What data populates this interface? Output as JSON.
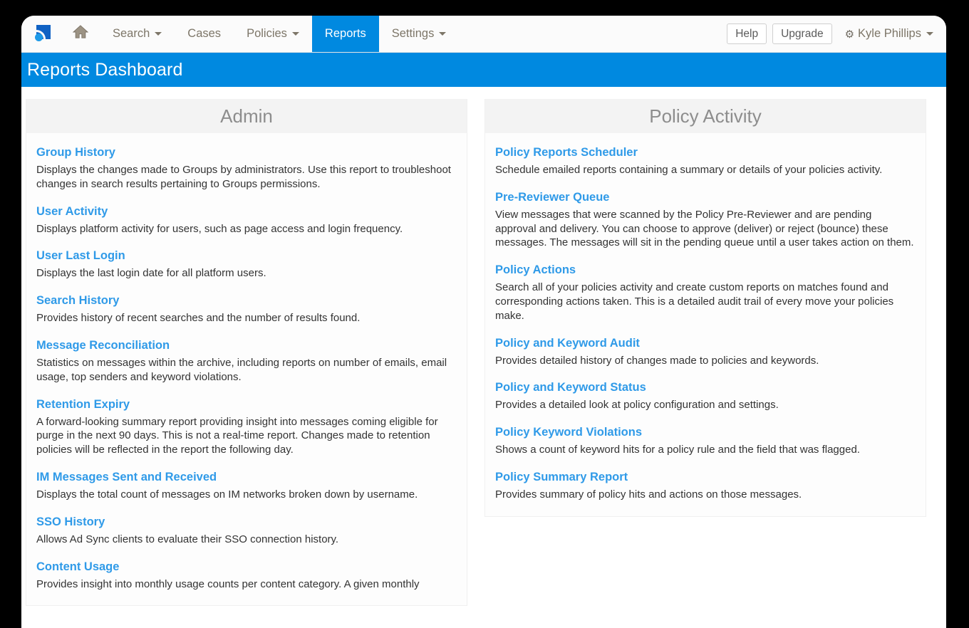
{
  "navbar": {
    "brand_icon": "signal-logo-icon",
    "home_icon": "home-icon",
    "items": [
      {
        "label": "Search",
        "has_caret": true,
        "active": false
      },
      {
        "label": "Cases",
        "has_caret": false,
        "active": false
      },
      {
        "label": "Policies",
        "has_caret": true,
        "active": false
      },
      {
        "label": "Reports",
        "has_caret": false,
        "active": true
      },
      {
        "label": "Settings",
        "has_caret": true,
        "active": false
      }
    ],
    "help_label": "Help",
    "upgrade_label": "Upgrade",
    "user_name": "Kyle Phillips",
    "user_icon": "gear-icon"
  },
  "banner": {
    "title": "Reports Dashboard",
    "color": "#0089e0"
  },
  "columns": [
    {
      "title": "Admin",
      "items": [
        {
          "title": "Group History",
          "desc": "Displays the changes made to Groups by administrators. Use this report to troubleshoot changes in search results pertaining to Groups permissions."
        },
        {
          "title": "User Activity",
          "desc": "Displays platform activity for users, such as page access and login frequency."
        },
        {
          "title": "User Last Login",
          "desc": "Displays the last login date for all platform users."
        },
        {
          "title": "Search History",
          "desc": "Provides history of recent searches and the number of results found."
        },
        {
          "title": "Message Reconciliation",
          "desc": "Statistics on messages within the archive, including reports on number of emails, email usage, top senders and keyword violations."
        },
        {
          "title": "Retention Expiry",
          "desc": "A forward-looking summary report providing insight into messages coming eligible for purge in the next 90 days. This is not a real-time report. Changes made to retention policies will be reflected in the report the following day."
        },
        {
          "title": "IM Messages Sent and Received",
          "desc": "Displays the total count of messages on IM networks broken down by username."
        },
        {
          "title": "SSO History",
          "desc": "Allows Ad Sync clients to evaluate their SSO connection history."
        },
        {
          "title": "Content Usage",
          "desc": "Provides insight into monthly usage counts per content category. A given monthly"
        }
      ]
    },
    {
      "title": "Policy Activity",
      "items": [
        {
          "title": "Policy Reports Scheduler",
          "desc": "Schedule emailed reports containing a summary or details of your policies activity."
        },
        {
          "title": "Pre-Reviewer Queue",
          "desc": "View messages that were scanned by the Policy Pre-Reviewer and are pending approval and delivery. You can choose to approve (deliver) or reject (bounce) these messages. The messages will sit in the pending queue until a user takes action on them."
        },
        {
          "title": "Policy Actions",
          "desc": "Search all of your policies activity and create custom reports on matches found and corresponding actions taken. This is a detailed audit trail of every move your policies make."
        },
        {
          "title": "Policy and Keyword Audit",
          "desc": "Provides detailed history of changes made to policies and keywords."
        },
        {
          "title": "Policy and Keyword Status",
          "desc": "Provides a detailed look at policy configuration and settings."
        },
        {
          "title": "Policy Keyword Violations",
          "desc": "Shows a count of keyword hits for a policy rule and the field that was flagged."
        },
        {
          "title": "Policy Summary Report",
          "desc": "Provides summary of policy hits and actions on those messages."
        }
      ]
    }
  ],
  "colors": {
    "accent_blue": "#0089e0",
    "link_blue": "#2f9ae8",
    "panel_header_gray": "#f3f3f3",
    "nav_text": "#7d7668"
  }
}
